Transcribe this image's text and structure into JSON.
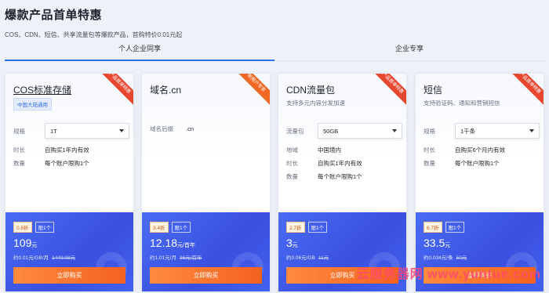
{
  "header": {
    "title": "爆款产品首单特惠",
    "subtitle": "COS、CDN、短信、共享流量包等爆款产品，首购特价0.01元起"
  },
  "tabs": [
    {
      "label": "个人企业同享"
    },
    {
      "label": "企业专享"
    }
  ],
  "cards": [
    {
      "ribbon": "产品首单特惠",
      "name": "COS标准存储",
      "region_badge": "中国大陆通用",
      "spec_label": "规格",
      "spec_value": "1T",
      "duration_label": "时长",
      "duration_value": "自购买1年内有效",
      "qty_label": "数量",
      "qty_value": "每个账户限购1个",
      "discount": "0.8折",
      "limit": "限1个",
      "price": "109",
      "price_unit": "元",
      "price_sub": "约0.01元/GB/月",
      "original": "1449.98元",
      "buy": "立即购买"
    },
    {
      "ribbon": "新用户专享",
      "name": "域名.cn",
      "suffix_label": "域名后缀",
      "suffix_value": ".cn",
      "discount": "3.4折",
      "limit": "限1个",
      "price": "12.18",
      "price_unit": "元/首年",
      "price_sub": "约1.01元/月",
      "original": "36元/首年",
      "buy": "立即购买"
    },
    {
      "ribbon": "产品首单特惠",
      "name": "CDN流量包",
      "desc": "支持多元内容分发加速",
      "spec_label": "流量包",
      "spec_value": "50GB",
      "region_label": "地域",
      "region_value": "中国境内",
      "duration_label": "时长",
      "duration_value": "自购买1年内有效",
      "qty_label": "数量",
      "qty_value": "每个账户限购1个",
      "discount": "2.7折",
      "limit": "限1个",
      "price": "3",
      "price_unit": "元",
      "price_sub": "约0.06元/GB",
      "original": "11元",
      "buy": "立即购买"
    },
    {
      "ribbon": "产品首单特惠",
      "name": "短信",
      "desc": "支持验证码、通知和营销短信",
      "spec_label": "规格",
      "spec_value": "1千条",
      "duration_label": "时长",
      "duration_value": "自购买6个月内有效",
      "qty_label": "数量",
      "qty_value": "每个账户限购1个",
      "discount": "6.7折",
      "limit": "限1个",
      "price": "33.5",
      "price_unit": "元",
      "price_sub": "约0.034元/条",
      "original": "50元",
      "buy": "立即购买"
    }
  ],
  "watermark": "云服务器网 www.yuntue.com",
  "colors": {
    "accent": "#2f6fe9",
    "buy_button": "#f4621f",
    "card_bottom": "#3a4fe0",
    "ribbon_red": "#e6472e",
    "ribbon_orange": "#f06a26"
  }
}
